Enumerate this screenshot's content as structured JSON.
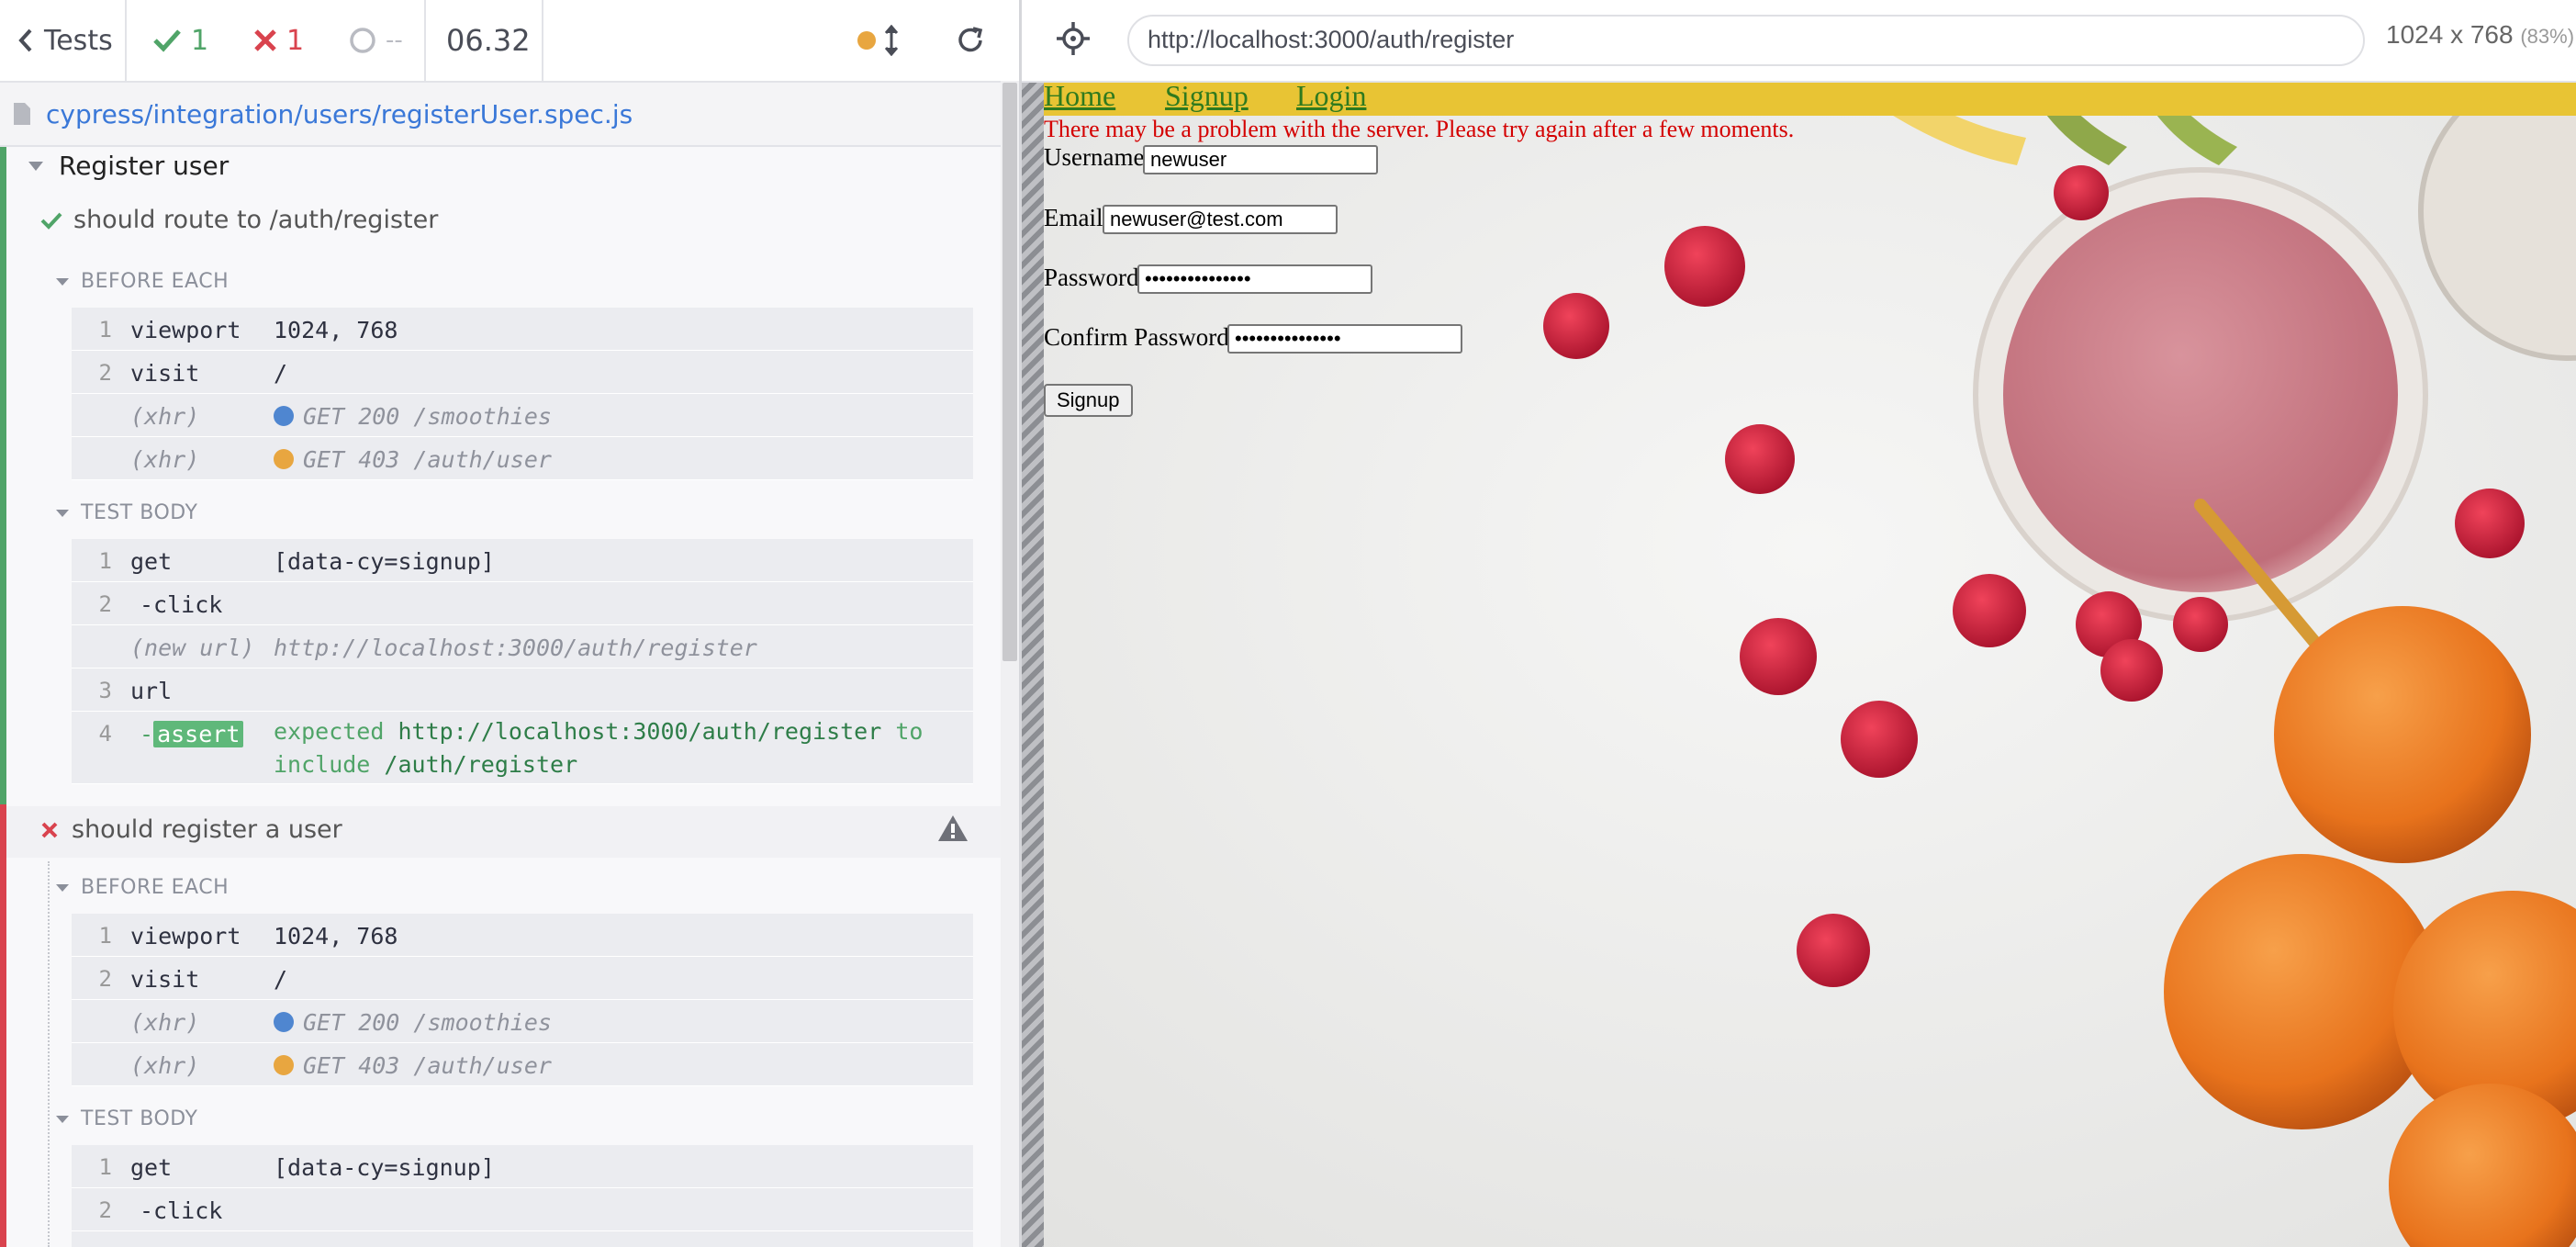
{
  "reporter": {
    "back_label": "Tests",
    "passed_count": "1",
    "failed_count": "1",
    "pending_count": "--",
    "duration": "06.32",
    "spec_path": "cypress/integration/users/registerUser.spec.js",
    "suite_title": "Register user",
    "tests": [
      {
        "title": "should route to /auth/register",
        "state": "passed",
        "before_each_label": "BEFORE EACH",
        "before_each": [
          {
            "num": "1",
            "name": "viewport",
            "msg": "1024, 768"
          },
          {
            "num": "2",
            "name": "visit",
            "msg": "/"
          },
          {
            "num": "",
            "name": "(xhr)",
            "msg": "GET 200 /smoothies",
            "dot": "#4f86d0"
          },
          {
            "num": "",
            "name": "(xhr)",
            "msg": "GET 403 /auth/user",
            "dot": "#e8a640"
          }
        ],
        "test_body_label": "TEST BODY",
        "test_body": [
          {
            "num": "1",
            "name": "get",
            "msg": "[data-cy=signup]"
          },
          {
            "num": "2",
            "name": "-click",
            "msg": ""
          },
          {
            "num": "",
            "name": "(new url)",
            "msg": "http://localhost:3000/auth/register"
          },
          {
            "num": "3",
            "name": "url",
            "msg": ""
          },
          {
            "num": "4",
            "name": "-",
            "badge": "assert",
            "msg_parts": [
              "expected",
              "http://localhost:3000/auth/register",
              "to",
              "include",
              "/auth/register"
            ]
          }
        ]
      },
      {
        "title": "should register a user",
        "state": "failed",
        "before_each_label": "BEFORE EACH",
        "before_each": [
          {
            "num": "1",
            "name": "viewport",
            "msg": "1024, 768"
          },
          {
            "num": "2",
            "name": "visit",
            "msg": "/"
          },
          {
            "num": "",
            "name": "(xhr)",
            "msg": "GET 200 /smoothies",
            "dot": "#4f86d0"
          },
          {
            "num": "",
            "name": "(xhr)",
            "msg": "GET 403 /auth/user",
            "dot": "#e8a640"
          }
        ],
        "test_body_label": "TEST BODY",
        "test_body": [
          {
            "num": "1",
            "name": "get",
            "msg": "[data-cy=signup]"
          },
          {
            "num": "2",
            "name": "-click",
            "msg": ""
          }
        ]
      }
    ]
  },
  "aut": {
    "url": "http://localhost:3000/auth/register",
    "viewport_size": "1024 x 768",
    "viewport_scale": "(83%)",
    "nav": [
      "Home",
      "Signup",
      "Login"
    ],
    "error": "There may be a problem with the server. Please try again after a few moments.",
    "form": {
      "username_label": "Username",
      "username_value": "newuser",
      "email_label": "Email",
      "email_value": "newuser@test.com",
      "password_label": "Password",
      "password_value": "•••••••••••••••",
      "confirm_label": "Confirm Password",
      "confirm_value": "•••••••••••••••",
      "submit_label": "Signup"
    }
  },
  "colors": {
    "pass": "#50a468",
    "fail": "#d9434e",
    "accent": "#3a78d8",
    "nav_bg": "#e8c434"
  }
}
